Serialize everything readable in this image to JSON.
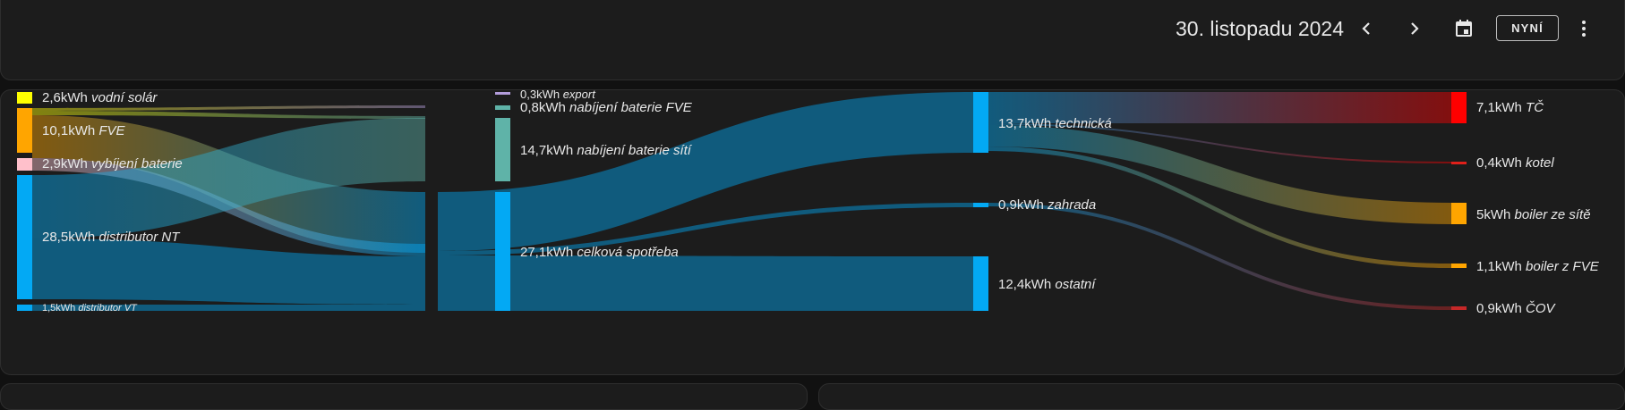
{
  "header": {
    "date": "30. listopadu 2024",
    "now_label": "NYNÍ",
    "icons": [
      "chevron-left-icon",
      "chevron-right-icon",
      "calendar-icon",
      "more-vert-icon"
    ]
  },
  "sankey": {
    "sources": [
      {
        "value": "2,6kWh",
        "name": "vodní solár",
        "color": "#ffff00"
      },
      {
        "value": "10,1kWh",
        "name": "FVE",
        "color": "#ffa500"
      },
      {
        "value": "2,9kWh",
        "name": "vybíjení baterie",
        "color": "#ffc0cb"
      },
      {
        "value": "28,5kWh",
        "name": "distributor NT",
        "color": "#03a9f4"
      },
      {
        "value": "1,5kWh",
        "name": "distributor VT",
        "color": "#03a9f4"
      }
    ],
    "middle": [
      {
        "value": "0,3kWh",
        "name": "export",
        "color": "#b39ddb"
      },
      {
        "value": "0,8kWh",
        "name": "nabíjení baterie FVE",
        "color": "#5fb3a8"
      },
      {
        "value": "14,7kWh",
        "name": "nabíjení baterie sítí",
        "color": "#5fb3a8"
      },
      {
        "value": "27,1kWh",
        "name": "celková spotřeba",
        "color": "#03a9f4"
      }
    ],
    "areas": [
      {
        "value": "13,7kWh",
        "name": "technická",
        "color": "#03a9f4"
      },
      {
        "value": "0,9kWh",
        "name": "zahrada",
        "color": "#03a9f4"
      },
      {
        "value": "12,4kWh",
        "name": "ostatní",
        "color": "#03a9f4"
      }
    ],
    "devices": [
      {
        "value": "7,1kWh",
        "name": "TČ",
        "color": "#ff0000"
      },
      {
        "value": "0,4kWh",
        "name": "kotel",
        "color": "#e0201a"
      },
      {
        "value": "5kWh",
        "name": "boiler ze sítě",
        "color": "#ffa500"
      },
      {
        "value": "1,1kWh",
        "name": "boiler z FVE",
        "color": "#ffa500"
      },
      {
        "value": "0,9kWh",
        "name": "ČOV",
        "color": "#c62828"
      }
    ]
  }
}
